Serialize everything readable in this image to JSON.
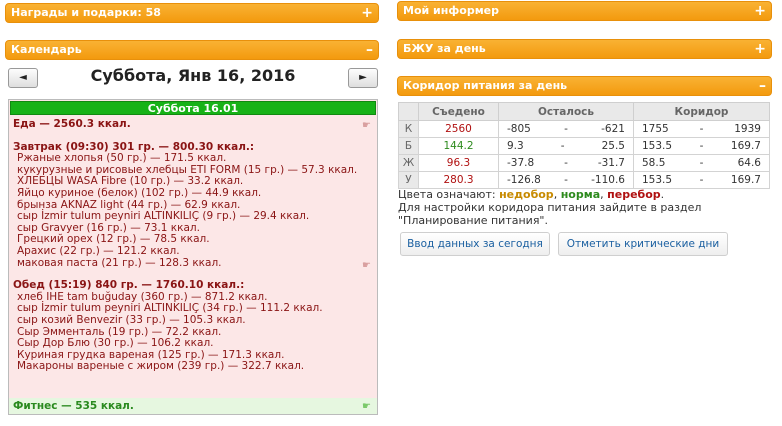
{
  "awards": {
    "title": "Награды и подарки: 58",
    "toggle": "+"
  },
  "informer": {
    "title": "Мой информер",
    "toggle": "+"
  },
  "calendar": {
    "title": "Календарь",
    "toggle": "–",
    "prev": "◄",
    "next": "►",
    "date_title": "Суббота, Янв 16, 2016",
    "day_bar": "Суббота 16.01",
    "food_total": "Еда — 2560.3 ккал.",
    "breakfast": {
      "header": "Завтрак (09:30) 301 гр. — 800.30 ккал.:",
      "items": [
        "Ржаные хлопья (50 гр.) — 171.5 ккал.",
        "кукурузные и рисовые хлебцы ETI FORM (15 гр.) — 57.3 ккал.",
        "ХЛЕБЦЫ WASA Fibre (10 гр.) — 33.2 ккал.",
        "Яйцо куриное (белок) (102 гр.) — 44.9 ккал.",
        "брынза AKNAZ light (44 гр.) — 62.9 ккал.",
        "сыр İzmir tulum peyniri ALTINKILIÇ (9 гр.) — 29.4 ккал.",
        "сыр Gravyer (16 гр.) — 73.1 ккал.",
        "Грецкий орех (12 гр.) — 78.5 ккал.",
        "Арахис (22 гр.) — 121.2 ккал.",
        "маковая паста (21 гр.) — 128.3 ккал."
      ]
    },
    "lunch": {
      "header": "Обед (15:19) 840 гр. — 1760.10 ккал.:",
      "items": [
        "хлеб IHE tam buğuday (360 гр.) — 871.2 ккал.",
        "сыр İzmir tulum peyniri ALTINKILIÇ (34 гр.) — 111.2 ккал.",
        "сыр козий Benvezir (33 гр.) — 105.3 ккал.",
        "Сыр Эмменталь (19 гр.) — 72.2 ккал.",
        "Сыр Дор Блю (30 гр.) — 106.2 ккал.",
        "Куриная грудка вареная (125 гр.) — 171.3 ккал.",
        "Макароны вареные с жиром (239 гр.) — 322.7 ккал."
      ]
    },
    "fitness": "Фитнес — 535 ккал."
  },
  "bju": {
    "title": "БЖУ за день",
    "toggle": "+"
  },
  "corridor": {
    "title": "Коридор питания за день",
    "toggle": "–",
    "headers": [
      "Съедено",
      "Осталось",
      "Коридор"
    ],
    "rows": [
      {
        "label": "К",
        "eaten": "2560",
        "eaten_color": "#b01010",
        "left_min": "-805",
        "left_sep": "-",
        "left_max": "-621",
        "corr_min": "1755",
        "corr_sep": "-",
        "corr_max": "1939"
      },
      {
        "label": "Б",
        "eaten": "144.2",
        "eaten_color": "#2d8a1d",
        "left_min": "9.3",
        "left_sep": "-",
        "left_max": "25.5",
        "corr_min": "153.5",
        "corr_sep": "-",
        "corr_max": "169.7"
      },
      {
        "label": "Ж",
        "eaten": "96.3",
        "eaten_color": "#b01010",
        "left_min": "-37.8",
        "left_sep": "-",
        "left_max": "-31.7",
        "corr_min": "58.5",
        "corr_sep": "-",
        "corr_max": "64.6"
      },
      {
        "label": "У",
        "eaten": "280.3",
        "eaten_color": "#b01010",
        "left_min": "-126.8",
        "left_sep": "-",
        "left_max": "-110.6",
        "corr_min": "153.5",
        "corr_sep": "-",
        "corr_max": "169.7"
      }
    ],
    "legend_prefix": "Цвета означают:",
    "legend_under": "недобор",
    "legend_norm": "норма",
    "legend_over": "перебор",
    "legend_sep": ",",
    "legend_end": ".",
    "hint": "Для настройки коридора питания зайдите в раздел \"Планирование питания\".",
    "btn_enter": "Ввод данных за сегодня",
    "btn_critical": "Отметить критические дни"
  }
}
